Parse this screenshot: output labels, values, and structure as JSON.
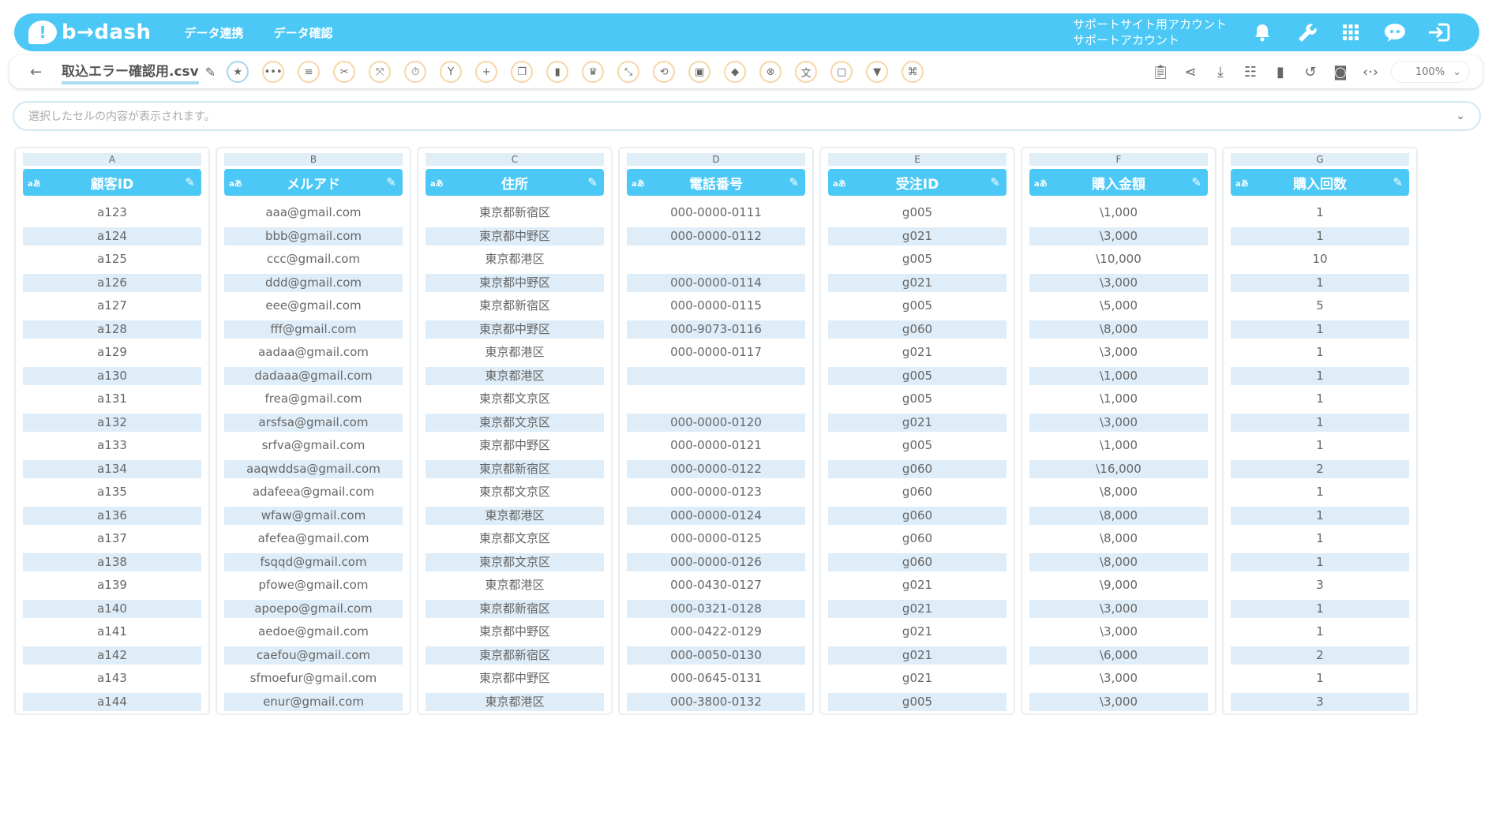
{
  "header": {
    "logo_text": "b→dash",
    "nav": [
      "データ連携",
      "データ確認"
    ],
    "account_line1": "サポートサイト用アカウント",
    "account_line2": "サポートアカウント",
    "icons": [
      "bell-icon",
      "wrench-icon",
      "grid-icon",
      "chat-bot-icon",
      "logout-icon"
    ]
  },
  "toolbar": {
    "filename": "取込エラー確認用.csv",
    "tools": [
      "star-icon",
      "more-icon",
      "list-icon",
      "scissors-icon",
      "expand-icon",
      "timer-icon",
      "merge-icon",
      "plus-icon",
      "copy-icon",
      "trash-icon",
      "crown-icon",
      "shrink-icon",
      "repeat-icon",
      "lock-icon",
      "bag-icon",
      "cancel-icon",
      "translate-icon",
      "frame-icon",
      "filter-icon",
      "tree-icon"
    ],
    "right_tools": [
      "clipboard-icon",
      "share-icon",
      "download-icon",
      "table-icon",
      "delete-icon",
      "history-icon",
      "search-doc-icon",
      "code-icon"
    ],
    "zoom": "100%"
  },
  "cellbar": {
    "placeholder": "選択したセルの内容が表示されます。"
  },
  "columns": [
    {
      "letter": "A",
      "type": "aあ",
      "title": "顧客ID",
      "values": [
        "a123",
        "a124",
        "a125",
        "a126",
        "a127",
        "a128",
        "a129",
        "a130",
        "a131",
        "a132",
        "a133",
        "a134",
        "a135",
        "a136",
        "a137",
        "a138",
        "a139",
        "a140",
        "a141",
        "a142",
        "a143",
        "a144"
      ]
    },
    {
      "letter": "B",
      "type": "aあ",
      "title": "メルアド",
      "values": [
        "aaa@gmail.com",
        "bbb@gmail.com",
        "ccc@gmail.com",
        "ddd@gmail.com",
        "eee@gmail.com",
        "fff@gmail.com",
        "aadaa@gmail.com",
        "dadaaa@gmail.com",
        "frea@gmail.com",
        "arsfsa@gmail.com",
        "srfva@gmail.com",
        "aaqwddsa@gmail.com",
        "adafeea@gmail.com",
        "wfaw@gmail.com",
        "afefea@gmail.com",
        "fsqqd@gmail.com",
        "pfowe@gmail.com",
        "apoepo@gmail.com",
        "aedoe@gmail.com",
        "caefou@gmail.com",
        "sfmoefur@gmail.com",
        "enur@gmail.com"
      ]
    },
    {
      "letter": "C",
      "type": "aあ",
      "title": "住所",
      "values": [
        "東京都新宿区",
        "東京都中野区",
        "東京都港区",
        "東京都中野区",
        "東京都新宿区",
        "東京都中野区",
        "東京都港区",
        "東京都港区",
        "東京都文京区",
        "東京都文京区",
        "東京都中野区",
        "東京都新宿区",
        "東京都文京区",
        "東京都港区",
        "東京都文京区",
        "東京都文京区",
        "東京都港区",
        "東京都新宿区",
        "東京都中野区",
        "東京都新宿区",
        "東京都中野区",
        "東京都港区"
      ]
    },
    {
      "letter": "D",
      "type": "aあ",
      "title": "電話番号",
      "values": [
        "000-0000-0111",
        "000-0000-0112",
        "",
        "000-0000-0114",
        "000-0000-0115",
        "000-9073-0116",
        "000-0000-0117",
        "",
        "",
        "000-0000-0120",
        "000-0000-0121",
        "000-0000-0122",
        "000-0000-0123",
        "000-0000-0124",
        "000-0000-0125",
        "000-0000-0126",
        "000-0430-0127",
        "000-0321-0128",
        "000-0422-0129",
        "000-0050-0130",
        "000-0645-0131",
        "000-3800-0132"
      ]
    },
    {
      "letter": "E",
      "type": "aあ",
      "title": "受注ID",
      "values": [
        "g005",
        "g021",
        "g005",
        "g021",
        "g005",
        "g060",
        "g021",
        "g005",
        "g005",
        "g021",
        "g005",
        "g060",
        "g060",
        "g060",
        "g060",
        "g060",
        "g021",
        "g021",
        "g021",
        "g021",
        "g021",
        "g005"
      ]
    },
    {
      "letter": "F",
      "type": "aあ",
      "title": "購入金額",
      "values": [
        "\\1,000",
        "\\3,000",
        "\\10,000",
        "\\3,000",
        "\\5,000",
        "\\8,000",
        "\\3,000",
        "\\1,000",
        "\\1,000",
        "\\3,000",
        "\\1,000",
        "\\16,000",
        "\\8,000",
        "\\8,000",
        "\\8,000",
        "\\8,000",
        "\\9,000",
        "\\3,000",
        "\\3,000",
        "\\6,000",
        "\\3,000",
        "\\3,000"
      ]
    },
    {
      "letter": "G",
      "type": "aあ",
      "title": "購入回数",
      "values": [
        "1",
        "1",
        "10",
        "1",
        "5",
        "1",
        "1",
        "1",
        "1",
        "1",
        "1",
        "2",
        "1",
        "1",
        "1",
        "1",
        "3",
        "1",
        "1",
        "2",
        "1",
        "3"
      ]
    }
  ]
}
